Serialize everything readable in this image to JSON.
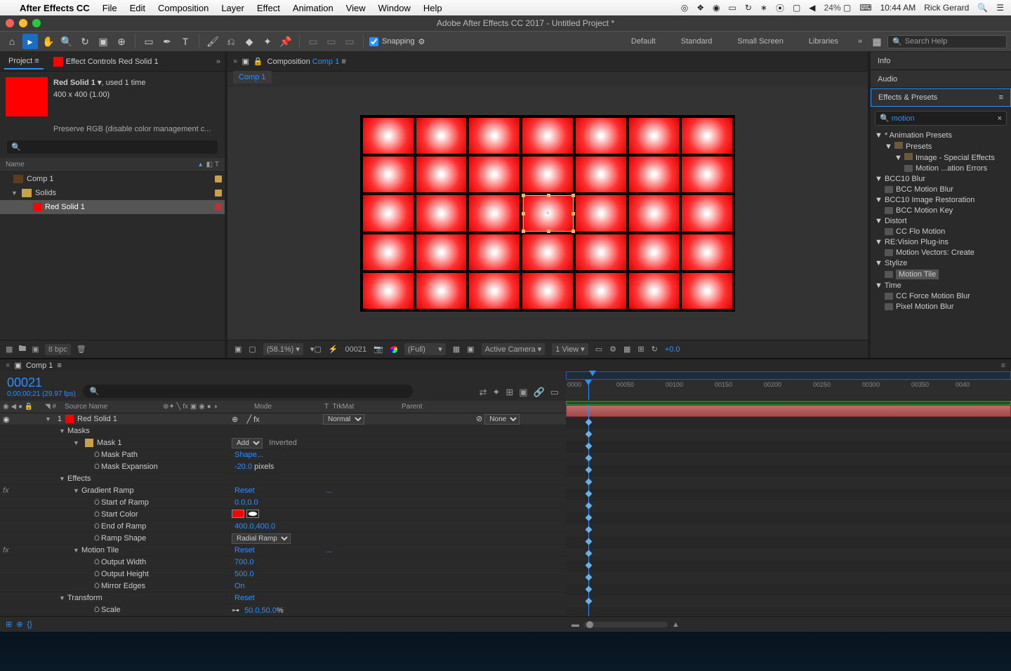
{
  "menubar": {
    "app": "After Effects CC",
    "items": [
      "File",
      "Edit",
      "Composition",
      "Layer",
      "Effect",
      "Animation",
      "View",
      "Window",
      "Help"
    ],
    "right": {
      "battery": "24%",
      "time": "10:44 AM",
      "user": "Rick Gerard"
    }
  },
  "window": {
    "title": "Adobe After Effects CC 2017 - Untitled Project *"
  },
  "toolbar": {
    "snapping_label": "Snapping",
    "workspaces": [
      "Default",
      "Standard",
      "Small Screen",
      "Libraries"
    ],
    "search_placeholder": "Search Help"
  },
  "project": {
    "tab1": "Project",
    "tab2": "Effect Controls Red Solid 1",
    "item_name": "Red Solid 1 ▾",
    "item_used": ", used 1 time",
    "item_dims": "400 x 400 (1.00)",
    "note": "Preserve RGB (disable color management c...",
    "col_name": "Name",
    "rows": {
      "comp": "Comp 1",
      "solids": "Solids",
      "red": "Red Solid 1"
    },
    "bpc": "8 bpc"
  },
  "comp": {
    "tab_prefix": "Composition",
    "tab_name": "Comp 1",
    "subtab": "Comp 1",
    "footer": {
      "zoom": "(58.1%)",
      "frame": "00021",
      "res": "(Full)",
      "cam": "Active Camera",
      "view": "1 View",
      "exp": "+0.0"
    }
  },
  "rightcol": {
    "info": "Info",
    "audio": "Audio",
    "fx": "Effects & Presets",
    "search": "motion",
    "tree": {
      "anim_presets": "* Animation Presets",
      "presets": "Presets",
      "img_sfx": "Image - Special Effects",
      "motion_err": "Motion ...ation Errors",
      "bcc_blur": "BCC10 Blur",
      "bcc_mblur": "BCC Motion Blur",
      "bcc_rest": "BCC10 Image Restoration",
      "bcc_mkey": "BCC Motion Key",
      "distort": "Distort",
      "flo": "CC Flo Motion",
      "revision": "RE:Vision Plug-ins",
      "mvec": "Motion Vectors: Create",
      "stylize": "Stylize",
      "mtile": "Motion Tile",
      "time": "Time",
      "force": "CC Force Motion Blur",
      "pixel": "Pixel Motion Blur"
    }
  },
  "timeline": {
    "tab": "Comp 1",
    "timecode": "00021",
    "fps": "0;00;00;21 (29.97 fps)",
    "cols": {
      "src": "Source Name",
      "mode": "Mode",
      "trk": "TrkMat",
      "parent": "Parent"
    },
    "layer": {
      "num": "1",
      "name": "Red Solid 1",
      "mode": "Normal",
      "parent": "None"
    },
    "props": {
      "masks": "Masks",
      "mask1": "Mask 1",
      "mask1_mode": "Add",
      "inverted": "Inverted",
      "mask_path": "Mask Path",
      "mask_path_v": "Shape...",
      "mask_exp": "Mask Expansion",
      "mask_exp_v": "-20.0",
      "pixels": " pixels",
      "effects": "Effects",
      "gramp": "Gradient Ramp",
      "reset": "Reset",
      "dots": "...",
      "start_ramp": "Start of Ramp",
      "start_ramp_v": "0.0,0.0",
      "start_color": "Start Color",
      "end_ramp": "End of Ramp",
      "end_ramp_v": "400.0,400.0",
      "ramp_shape": "Ramp Shape",
      "ramp_shape_v": "Radial Ramp",
      "mtile": "Motion Tile",
      "out_w": "Output Width",
      "out_w_v": "700.0",
      "out_h": "Output Height",
      "out_h_v": "500.0",
      "mirror": "Mirror Edges",
      "mirror_v": "On",
      "transform": "Transform",
      "scale": "Scale",
      "scale_v": "50.0,50.0",
      "pct": "%"
    },
    "ruler": [
      "0000",
      "00050",
      "00100",
      "00150",
      "00200",
      "00250",
      "00300",
      "00350",
      "0040"
    ]
  }
}
